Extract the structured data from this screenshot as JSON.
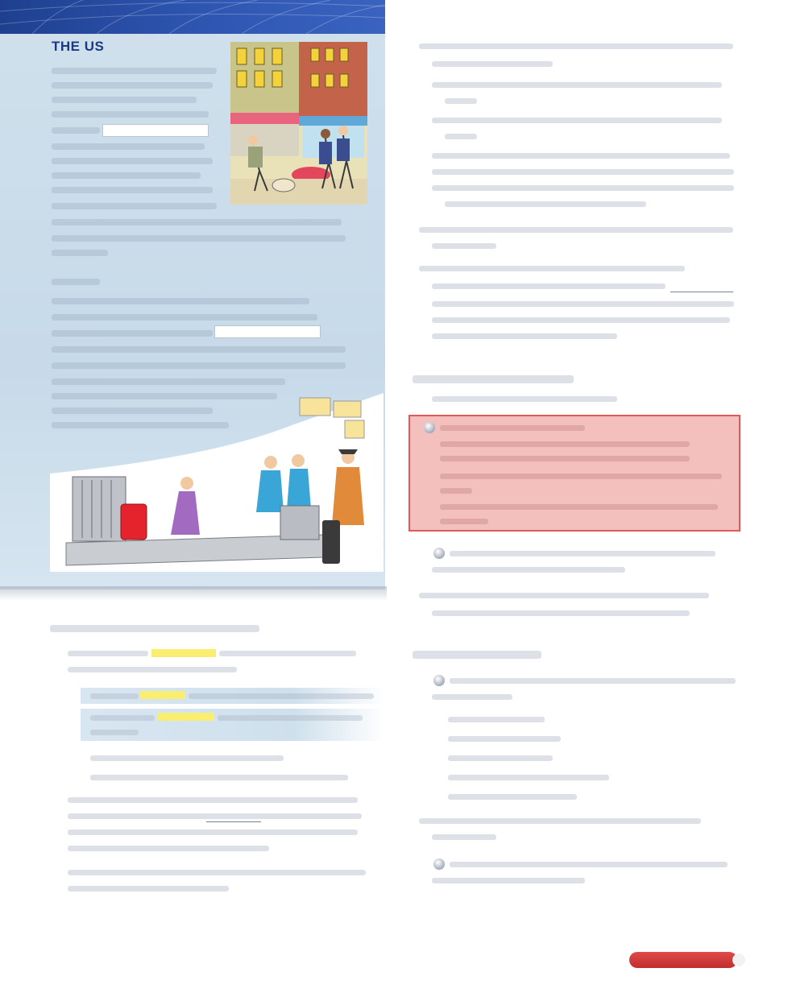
{
  "header": {
    "title": "THE US"
  },
  "colors": {
    "banner": "#2d55b0",
    "title": "#1b3a86",
    "panel": "#cfe0ec",
    "highlight": "#f9ee70",
    "alert_box_fill": "#f3c0bd",
    "alert_box_border": "#e15a5a",
    "page_tab": "#c12e2e"
  },
  "illustrations": {
    "street_scene": "street-scene-illustration",
    "airport_scene": "airport-baggage-carousel-illustration"
  }
}
